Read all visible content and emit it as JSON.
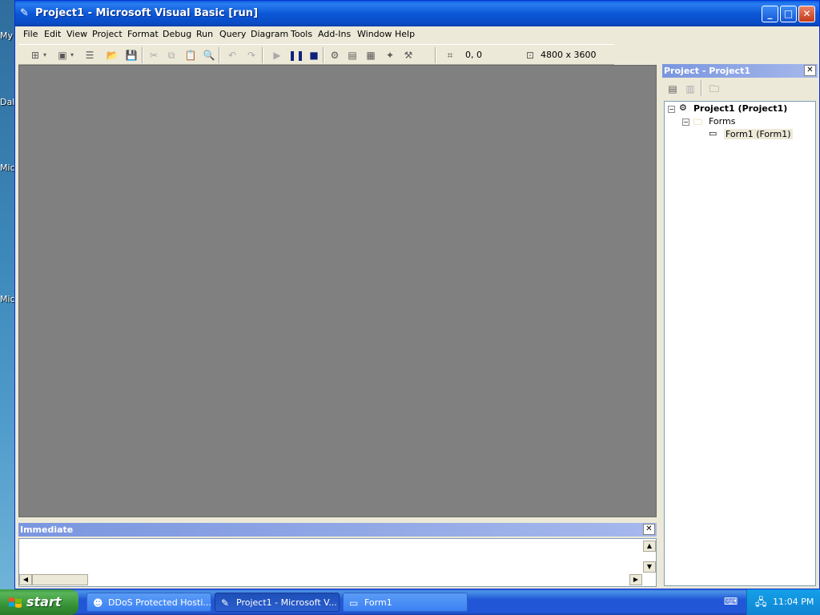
{
  "desktop": {
    "labels": [
      "My",
      "Dal",
      "Mic",
      "Mic"
    ]
  },
  "window": {
    "title": "Project1 - Microsoft Visual Basic [run]",
    "minimize_glyph": "_",
    "maximize_glyph": "□",
    "close_glyph": "✕"
  },
  "menu": {
    "items": [
      "File",
      "Edit",
      "View",
      "Project",
      "Format",
      "Debug",
      "Run",
      "Query",
      "Diagram",
      "Tools",
      "Add-Ins",
      "Window",
      "Help"
    ]
  },
  "toolbar": {
    "position_text": "0, 0",
    "size_text": "4800 x 3600"
  },
  "immediate": {
    "title": "Immediate",
    "close_glyph": "✕"
  },
  "project_explorer": {
    "title": "Project - Project1",
    "close_glyph": "✕",
    "tree": {
      "root": "Project1 (Project1)",
      "folder": "Forms",
      "form": "Form1 (Form1)"
    }
  },
  "taskbar": {
    "start_label": "start",
    "tasks": [
      {
        "label": "DDoS Protected Hosti..."
      },
      {
        "label": "Project1 - Microsoft V..."
      },
      {
        "label": "Form1"
      }
    ],
    "clock": "11:04 PM"
  },
  "colors": {
    "titlebar": "#0a58d8",
    "workspace": "#808080",
    "chrome": "#ece9d8",
    "taskbar": "#2157d7",
    "start": "#379437"
  }
}
